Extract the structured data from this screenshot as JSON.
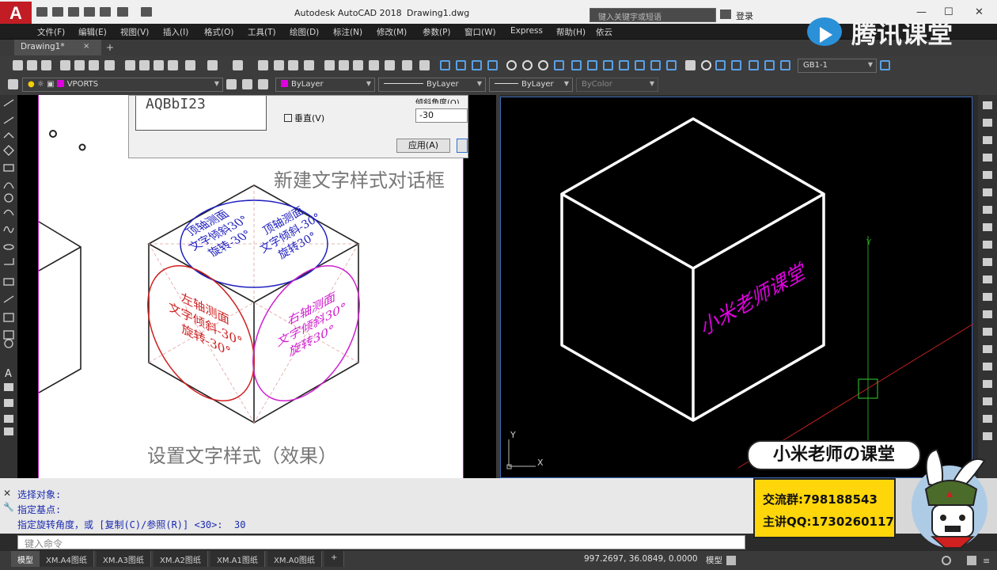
{
  "title_bar": {
    "app_title": "Autodesk AutoCAD 2018",
    "doc_name": "Drawing1.dwg",
    "search_placeholder": "键入关键字或短语",
    "login": "登录",
    "logo_letter": "A"
  },
  "watermark": {
    "text": "腾讯课堂"
  },
  "menu": [
    "文件(F)",
    "编辑(E)",
    "视图(V)",
    "插入(I)",
    "格式(O)",
    "工具(T)",
    "绘图(D)",
    "标注(N)",
    "修改(M)",
    "参数(P)",
    "窗口(W)",
    "Express",
    "帮助(H)",
    "依云"
  ],
  "doc_tab": {
    "label": "Drawing1*",
    "close": "×",
    "add": "+"
  },
  "toolbar": {
    "layer": "VPORTS",
    "color": "ByLayer",
    "linetype": "ByLayer",
    "lineweight": "ByLayer",
    "plotstyle": "ByColor",
    "dimstyle": "GB1-1"
  },
  "dialog": {
    "preview_text": "AQBbI23",
    "vertical_label": "垂直(V)",
    "oblique_label": "倾斜角度(O)",
    "oblique_value": "-30",
    "apply_label": "应用(A)"
  },
  "reference_image": {
    "heading_top": "新建文字样式对话框",
    "caption_bottom": "设置文字样式（效果）",
    "top_face": [
      "顶轴测面",
      "文字倾斜30°",
      "旋转-30°"
    ],
    "top_face_right": [
      "顶轴测面",
      "文字倾斜-30°",
      "旋转30°"
    ],
    "left_face": [
      "左轴测面",
      "文字倾斜-30°",
      "旋转-30°"
    ],
    "right_face": [
      "右轴测面",
      "文字倾斜30°",
      "旋转30°"
    ]
  },
  "model_view": {
    "cube_text": "小米老师课堂",
    "ucs_y": "Y",
    "ucs_x": "X"
  },
  "command": {
    "lines": [
      "选择对象:",
      "指定基点:",
      "指定旋转角度，或 [复制(C)/参照(R)] <30>:  30"
    ],
    "input_placeholder": "键入命令"
  },
  "layout_tabs": [
    "模型",
    "XM.A4图纸",
    "XM.A3图纸",
    "XM.A2图纸",
    "XM.A1图纸",
    "XM.A0图纸",
    "+"
  ],
  "status": {
    "coords": "997.2697, 36.0849, 0.0000",
    "mode": "模型"
  },
  "promo": {
    "title": "小米老师の课堂",
    "group_label": "交流群:798188543",
    "qq_label": "主讲QQ:1730260117"
  },
  "colors": {
    "accent_magenta": "#e000e0",
    "command_text": "#1a2ab0",
    "logo_red": "#c21d24",
    "promo_yellow": "#ffd60a"
  }
}
